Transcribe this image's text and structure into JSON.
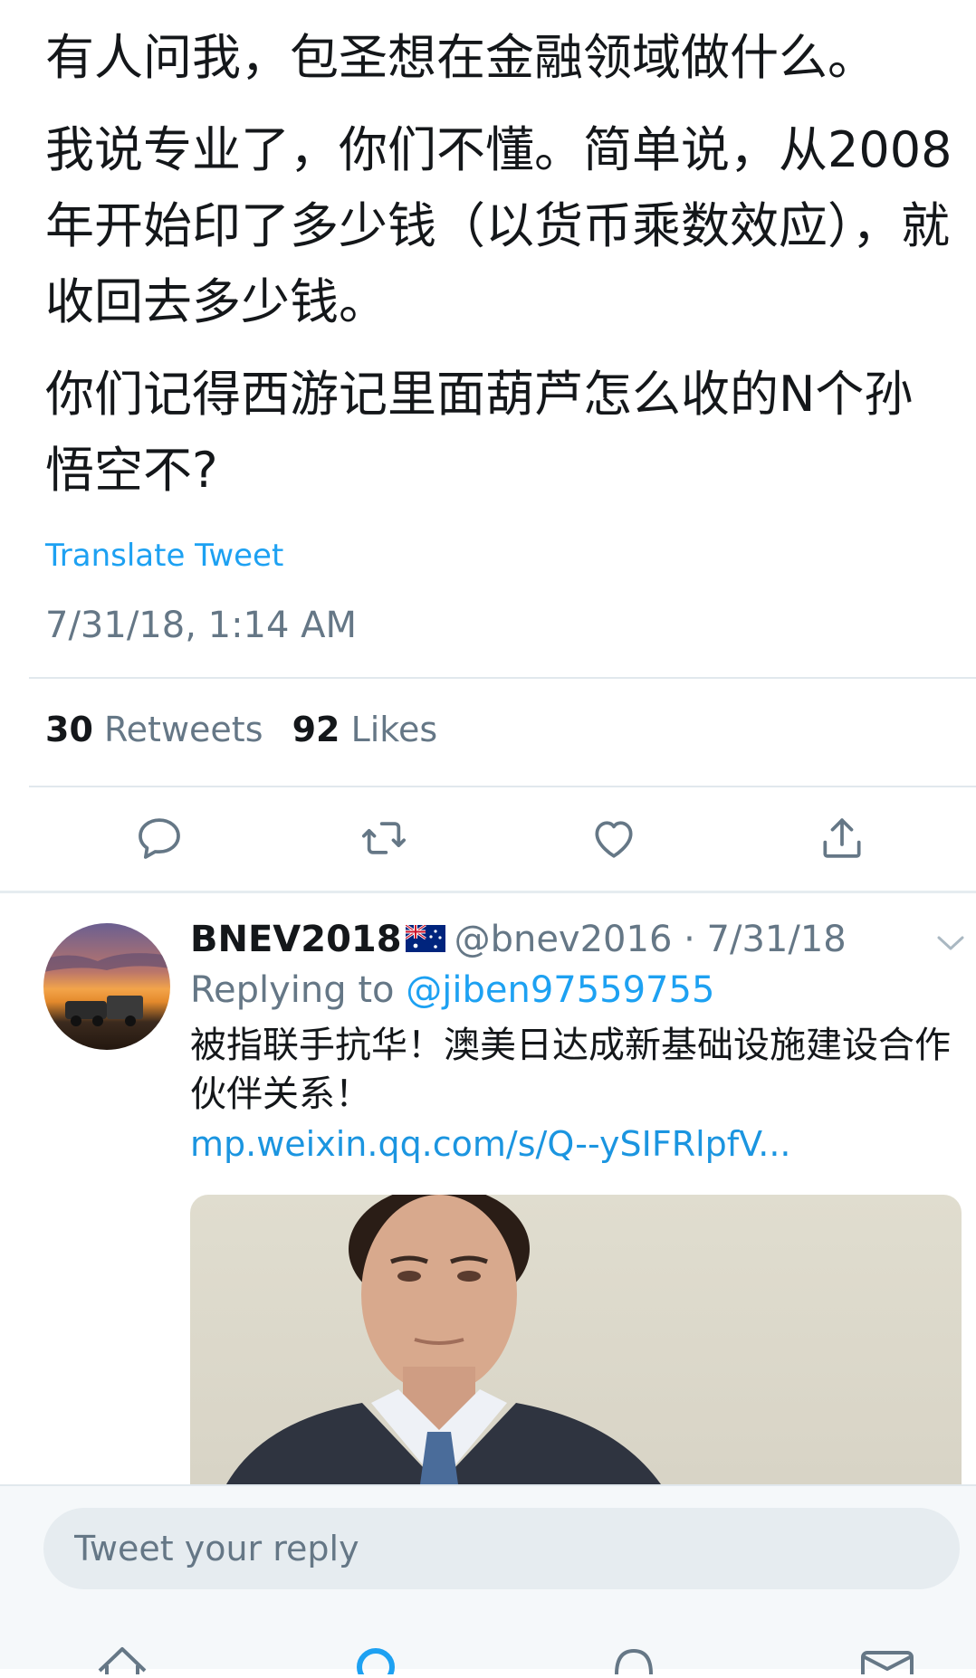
{
  "tweet": {
    "paragraphs": [
      "有人问我，包圣想在金融领域做什么。",
      "我说专业了，你们不懂。简单说，从2008年开始印了多少钱（以货币乘数效应），就收回去多少钱。",
      "你们记得西游记里面葫芦怎么收的N个孙悟空不?"
    ],
    "translate_label": "Translate Tweet",
    "timestamp": "7/31/18, 1:14 AM",
    "retweets_count": "30",
    "retweets_label": "Retweets",
    "likes_count": "92",
    "likes_label": "Likes"
  },
  "actions": {
    "icons": [
      "reply-icon",
      "retweet-icon",
      "like-icon",
      "share-icon"
    ]
  },
  "reply": {
    "display_name": "BNEV2018",
    "handle_time": "@bnev2016 · 7/31/18",
    "replying_prefix": "Replying to",
    "replying_handle": "@jiben97559755",
    "body": "被指联手抗华！澳美日达成新基础设施建设合作伙伴关系！",
    "link": "mp.weixin.qq.com/s/Q--ySIFRlpfV..."
  },
  "composer": {
    "placeholder": "Tweet your reply"
  },
  "tabbar": {
    "icons": [
      "home-icon",
      "search-icon",
      "notifications-icon",
      "messages-icon"
    ]
  },
  "colors": {
    "accent": "#1da1f2",
    "muted": "#657786",
    "text": "#14171a"
  }
}
